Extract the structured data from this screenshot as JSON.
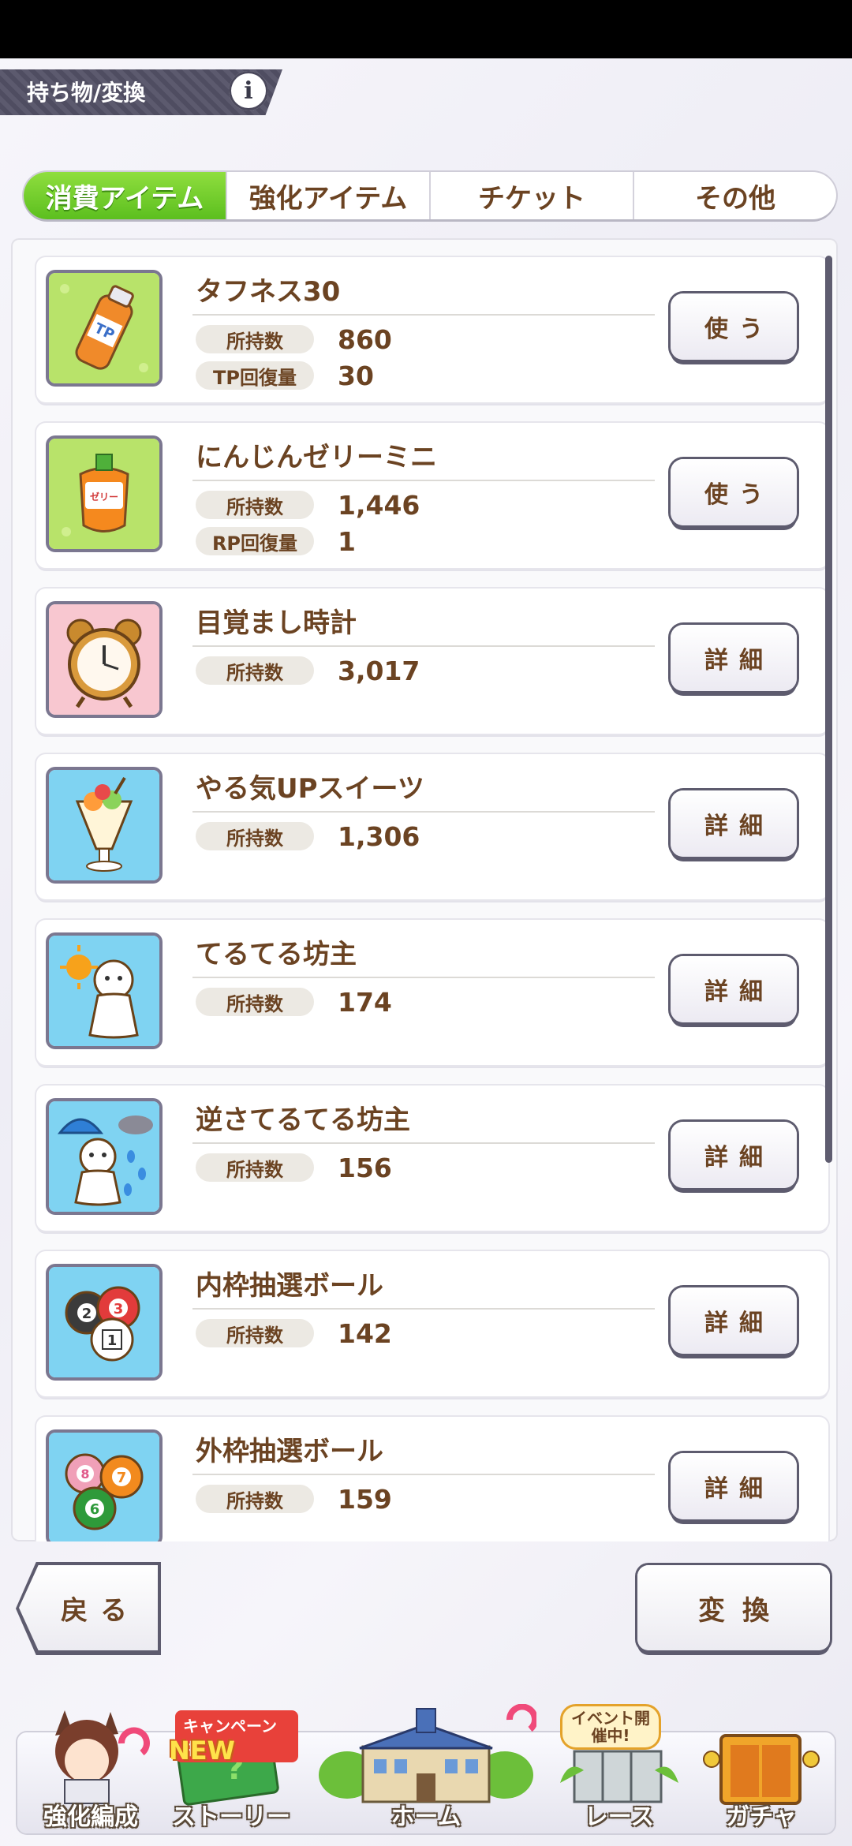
{
  "header": {
    "title": "持ち物/変換",
    "info_label": "i"
  },
  "tabs": [
    {
      "label": "消費アイテム",
      "active": true
    },
    {
      "label": "強化アイテム",
      "active": false
    },
    {
      "label": "チケット",
      "active": false
    },
    {
      "label": "その他",
      "active": false
    }
  ],
  "items": [
    {
      "name": "タフネス30",
      "icon": "tp-bottle-icon",
      "count_label": "所持数",
      "count": "860",
      "extra_label": "TP回復量",
      "extra_value": "30",
      "button": "使う"
    },
    {
      "name": "にんじんゼリーミニ",
      "icon": "carrot-jelly-icon",
      "count_label": "所持数",
      "count": "1,446",
      "extra_label": "RP回復量",
      "extra_value": "1",
      "button": "使う"
    },
    {
      "name": "目覚まし時計",
      "icon": "alarm-clock-icon",
      "count_label": "所持数",
      "count": "3,017",
      "button": "詳細"
    },
    {
      "name": "やる気UPスイーツ",
      "icon": "parfait-icon",
      "count_label": "所持数",
      "count": "1,306",
      "button": "詳細"
    },
    {
      "name": "てるてる坊主",
      "icon": "teru-teru-bozu-icon",
      "count_label": "所持数",
      "count": "174",
      "button": "詳細"
    },
    {
      "name": "逆さてるてる坊主",
      "icon": "upside-down-teru-teru-bozu-icon",
      "count_label": "所持数",
      "count": "156",
      "button": "詳細"
    },
    {
      "name": "内枠抽選ボール",
      "icon": "inner-lottery-ball-icon",
      "count_label": "所持数",
      "count": "142",
      "button": "詳細",
      "ball_numbers": [
        "2",
        "3",
        "1"
      ]
    },
    {
      "name": "外枠抽選ボール",
      "icon": "outer-lottery-ball-icon",
      "count_label": "所持数",
      "count": "159",
      "button": "詳細",
      "ball_numbers": [
        "8",
        "7",
        "6"
      ]
    }
  ],
  "footer": {
    "back_label": "戻る",
    "convert_label": "変換"
  },
  "nav": [
    {
      "label": "強化編成"
    },
    {
      "label": "ストーリー",
      "badge_top": "キャンペーン中",
      "badge_new": "NEW"
    },
    {
      "label": "ホーム"
    },
    {
      "label": "レース",
      "badge_event": "イベント開催中!"
    },
    {
      "label": "ガチャ"
    }
  ],
  "colors": {
    "accent_green": "#6ccf2a",
    "text_brown": "#6b4322",
    "nav_dark": "#5d5b6e"
  }
}
